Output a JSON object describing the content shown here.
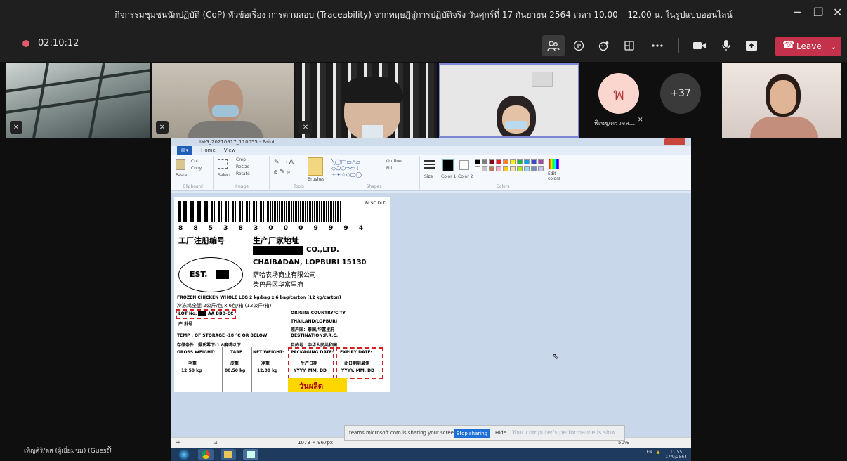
{
  "window": {
    "title": "กิจกรรมชุมชนนักปฏิบัติ (CoP) หัวข้อเรื่อง การตามสอบ (Traceability) จากทฤษฎีสู่การปฏิบัติจริง วันศุกร์ที่ 17 กันยายน 2564 เวลา 10.00 – 12.00 น. ในรูปแบบออนไลน์",
    "minimize": "─",
    "maximize": "❐",
    "close": "✕"
  },
  "meeting": {
    "timer": "02:10:12",
    "leave_label": "Leave",
    "overflow_count": "+37",
    "avatar_initial": "พ",
    "avatar_name": "พิเชฐ/ตรวจส..."
  },
  "icons": {
    "participants": "people-icon",
    "chat": "chat-icon",
    "reactions": "reactions-icon",
    "rooms": "rooms-icon",
    "more": "more-icon",
    "camera": "camera-icon",
    "mic": "mic-icon",
    "share": "share-icon"
  },
  "paint": {
    "window_title": "IMG_20210917_110055 - Paint",
    "tabs": [
      "Home",
      "View"
    ],
    "groups": [
      "Clipboard",
      "Image",
      "Tools",
      "Shapes",
      "Colors"
    ],
    "clipboard": {
      "paste": "Paste",
      "cut": "Cut",
      "copy": "Copy"
    },
    "image": {
      "select": "Select",
      "crop": "Crop",
      "resize": "Resize",
      "rotate": "Rotate"
    },
    "brushes": "Brushes",
    "outline": "Outline",
    "fill": "Fill",
    "size": "Size",
    "color1": "Color 1",
    "color2": "Color 2",
    "edit_colors": "Edit colors",
    "dimensions": "1073 × 967px",
    "zoom": "50%"
  },
  "label": {
    "blsc": "BLSC DLD",
    "digits": "8 8 5 3 8 3 0 0 0 9 9 9 4",
    "factory_reg": "工厂注册编号",
    "factory_addr": "生产厂家地址",
    "co_ltd": "CO.,LTD.",
    "est": "EST.",
    "city": "CHAIBADAN, LOPBURI 15130",
    "cn_company": "萨哈农场商业有限公司",
    "cn_district": "柴巴丹区华富里府",
    "product": "FROZEN CHICKEN WHOLE LEG 2 kg/bag x 6 bag/carton (12 kg/carton)",
    "product_cn": "冷冻鸡全腿   2公斤/包 x 6包/箱 (12公斤/箱)",
    "lot": "LOT No.",
    "lot_code": "AA BBB-CC",
    "batch_cn": "产 批号",
    "origin": "ORIGIN: COUNTRY/CITY",
    "origin_value": "THAILAND/LOPBURI",
    "origin_cn": "原产国：泰国/华富里府",
    "temp": "TEMP . OF STORAGE -18 °C OR BELOW",
    "destination": "DESTINATION:P.R.C.",
    "storage_cn": "存储条件：摄氏零下-1 8度或以下",
    "destination_cn": "目的地：中华人民共和国",
    "gross": "GROSS WEIGHT:",
    "tare": "TARE",
    "net": "NET WEIGHT:",
    "packaging_date": "PACKAGING DATE:",
    "expiry_date": "EXPIRY DATE:",
    "gross_cn": "毛重",
    "tare_cn": "皮重",
    "net_cn": "净重",
    "pack_cn": "生产日期",
    "exp_cn": "此日期前最佳",
    "gross_val": "12.50 kg",
    "tare_val": "00.50 kg",
    "net_val": "12.00 kg",
    "date_fmt1": "YYYY. MM. DD",
    "date_fmt2": "YYYY. MM. DD",
    "thai_tag": "วันผลิต"
  },
  "notification": {
    "text": "teams.microsoft.com is sharing your screen.",
    "stop": "Stop sharing",
    "hide": "Hide",
    "perf": "Your computer's performance is slow"
  },
  "taskbar": {
    "lang": "EN",
    "time": "11:55",
    "date": "17/9/2564"
  },
  "guest_name": "เพ็ญศิริ/ตส (ผู้เยี่ยมชม) (Guest)"
}
